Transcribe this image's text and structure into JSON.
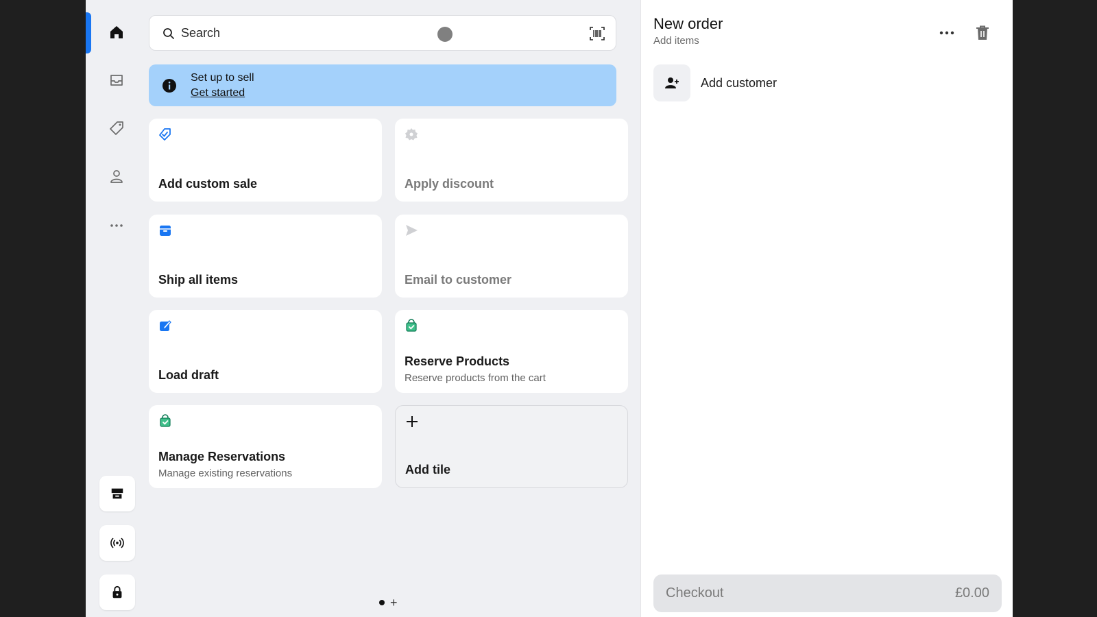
{
  "search": {
    "placeholder": "Search"
  },
  "banner": {
    "title": "Set up to sell",
    "link": "Get started"
  },
  "tiles": [
    {
      "title": "Add custom sale",
      "icon": "tag-check-icon"
    },
    {
      "title": "Apply discount",
      "icon": "discount-badge-icon"
    },
    {
      "title": "Ship all items",
      "icon": "box-icon"
    },
    {
      "title": "Email to customer",
      "icon": "send-icon"
    },
    {
      "title": "Load draft",
      "icon": "draft-edit-icon"
    },
    {
      "title": "Reserve Products",
      "subtitle": "Reserve products from the cart",
      "icon": "shopping-bag-check-icon"
    },
    {
      "title": "Manage Reservations",
      "subtitle": "Manage existing reservations",
      "icon": "shopping-bag-check-icon"
    },
    {
      "title": "Add tile",
      "icon": "plus-icon"
    }
  ],
  "order": {
    "title": "New order",
    "subtitle": "Add items",
    "add_customer": "Add customer",
    "checkout_label": "Checkout",
    "checkout_amount": "£0.00"
  },
  "colors": {
    "accent": "#1976f2",
    "banner": "#a4d1fb",
    "icon_blue": "#1976f2",
    "icon_green": "#0e9e6b"
  }
}
